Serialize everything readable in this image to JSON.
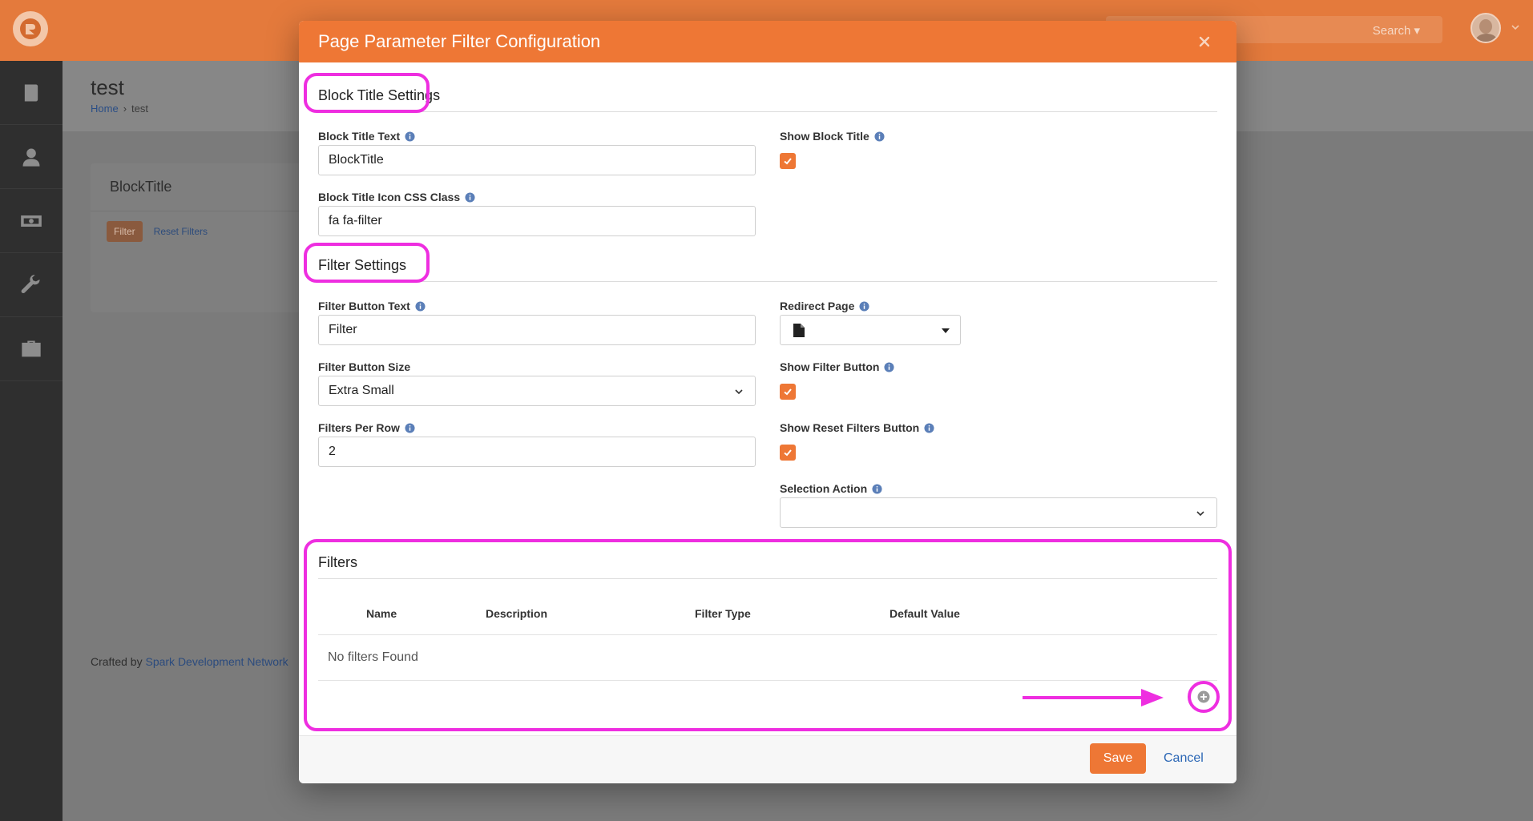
{
  "app": {
    "search_label": "Search",
    "page_title": "test",
    "breadcrumb": [
      "Home",
      "test"
    ],
    "block_title": "BlockTitle",
    "bg_filter_button": "Filter",
    "bg_reset_link": "Reset Filters",
    "footer_prefix": "Crafted by",
    "footer_link": "Spark Development Network"
  },
  "modal": {
    "title": "Page Parameter Filter Configuration",
    "block_title_settings": {
      "heading": "Block Title Settings",
      "block_title_text_label": "Block Title Text",
      "block_title_text_value": "BlockTitle",
      "icon_css_label": "Block Title Icon CSS Class",
      "icon_css_value": "fa fa-filter",
      "show_block_title_label": "Show Block Title",
      "show_block_title_checked": true
    },
    "filter_settings": {
      "heading": "Filter Settings",
      "filter_button_text_label": "Filter Button Text",
      "filter_button_text_value": "Filter",
      "filter_button_size_label": "Filter Button Size",
      "filter_button_size_value": "Extra Small",
      "filters_per_row_label": "Filters Per Row",
      "filters_per_row_value": "2",
      "redirect_page_label": "Redirect Page",
      "show_filter_button_label": "Show Filter Button",
      "show_filter_button_checked": true,
      "show_reset_filters_label": "Show Reset Filters Button",
      "show_reset_filters_checked": true,
      "selection_action_label": "Selection Action",
      "selection_action_value": ""
    },
    "filters": {
      "heading": "Filters",
      "columns": [
        "Name",
        "Description",
        "Filter Type",
        "Default Value"
      ],
      "empty_message": "No filters Found"
    },
    "footer": {
      "save_label": "Save",
      "cancel_label": "Cancel"
    }
  },
  "colors": {
    "brand_orange": "#ee7735",
    "callout_magenta": "#ee2ee0",
    "link_blue": "#2a66b5"
  },
  "icons": [
    "rock-logo-icon",
    "book-icon",
    "user-icon",
    "money-icon",
    "wrench-icon",
    "briefcase-icon",
    "close-icon",
    "info-icon",
    "check-icon",
    "chevron-down-icon",
    "file-icon",
    "caret-down-icon",
    "add-circle-icon"
  ]
}
